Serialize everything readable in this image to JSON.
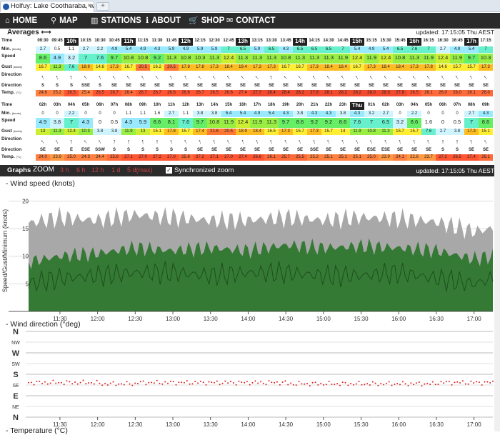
{
  "browser": {
    "tab_title": "Holfuy: Lake Cootharaba, w...",
    "tab_close": "×",
    "new_tab": "+"
  },
  "nav": [
    {
      "icon": "⌂",
      "icon_name": "home-icon",
      "label": "HOME",
      "x": 2
    },
    {
      "icon": "⚲",
      "icon_name": "map-icon",
      "label": "MAP",
      "x": 66
    },
    {
      "icon": "▥",
      "icon_name": "stations-icon",
      "label": "STATIONS",
      "x": 122
    },
    {
      "icon": "ℹ",
      "icon_name": "info-icon",
      "label": "ABOUT",
      "x": 199
    },
    {
      "icon": "🛒",
      "icon_name": "cart-icon",
      "label": "SHOP",
      "x": 259
    },
    {
      "icon": "✉",
      "icon_name": "mail-icon",
      "label": "CONTACT",
      "x": 312
    }
  ],
  "averages": {
    "title": "Averages ⟷",
    "updated": "updated: 17:15:05 Thu AEST"
  },
  "row_labels": {
    "time": "Time",
    "min": "Min.",
    "min_unit": "(knots)",
    "speed": "Speed",
    "gust": "Gust",
    "gust_unit": "(knots)",
    "direction": "Direction",
    "temp": "Temp.",
    "temp_unit": "(°C)"
  },
  "table1": {
    "time": [
      "09:30",
      "09:45",
      "10h",
      "10:15",
      "10:30",
      "10:45",
      "11h",
      "11:15",
      "11:30",
      "11:45",
      "12h",
      "12:15",
      "12:30",
      "12:45",
      "13h",
      "13:15",
      "13:30",
      "13:45",
      "14h",
      "14:15",
      "14:30",
      "14:45",
      "15h",
      "15:15",
      "15:30",
      "15:45",
      "16h",
      "16:15",
      "16:30",
      "16:45",
      "17h",
      "17:15"
    ],
    "min": [
      "2.7",
      "0.5",
      "1.1",
      "2.7",
      "2.2",
      "4.9",
      "5.4",
      "4.9",
      "4.3",
      "5.9",
      "4.9",
      "5.9",
      "5.9",
      "7",
      "6.5",
      "5.9",
      "6.5",
      "4.3",
      "6.5",
      "6.5",
      "6.5",
      "7",
      "5.4",
      "4.9",
      "5.4",
      "6.5",
      "7.6",
      "7",
      "2.7",
      "4.9",
      "5.4",
      "7"
    ],
    "speed": [
      "8.6",
      "4.9",
      "3.2",
      "7",
      "7.6",
      "9.7",
      "10.8",
      "10.8",
      "9.2",
      "11.3",
      "10.8",
      "10.3",
      "11.3",
      "12.4",
      "11.3",
      "11.3",
      "11.3",
      "10.8",
      "11.3",
      "11.3",
      "11.3",
      "11.9",
      "12.4",
      "11.9",
      "12.4",
      "10.8",
      "11.3",
      "11.9",
      "12.4",
      "11.9",
      "9.7",
      "10.3"
    ],
    "gust": [
      "16.7",
      "11.3",
      "7.6",
      "18.9",
      "14.6",
      "17.3",
      "16.7",
      "20.5",
      "16.2",
      "20.5",
      "17.8",
      "17.8",
      "17.3",
      "18.4",
      "19.4",
      "17.3",
      "17.3",
      "16.7",
      "16.7",
      "17.3",
      "18.4",
      "18.4",
      "16.7",
      "17.3",
      "18.4",
      "18.4",
      "17.3",
      "17.8",
      "14.6",
      "15.7",
      "15.7",
      "17.3"
    ],
    "dir": [
      340,
      -10,
      -20,
      320,
      -20,
      320,
      320,
      -30,
      320,
      330,
      -20,
      315,
      320,
      325,
      320,
      315,
      -20,
      310,
      315,
      325,
      320,
      325,
      -30,
      320,
      320,
      310,
      315,
      320,
      -30,
      325,
      330,
      320
    ],
    "dirtext": [
      "S",
      "S",
      "S",
      "SSE",
      "S",
      "SE",
      "SE",
      "SE",
      "SE",
      "SE",
      "SE",
      "SE",
      "SE",
      "SE",
      "SE",
      "SE",
      "SE",
      "SE",
      "SE",
      "SE",
      "SE",
      "SE",
      "SE",
      "SE",
      "SE",
      "SE",
      "SE",
      "SE",
      "SE",
      "SE",
      "SE",
      "SE"
    ],
    "temp": [
      "24.6",
      "25.2",
      "26.5",
      "25.4",
      "26.5",
      "26.7",
      "26.4",
      "26.7",
      "26.7",
      "26.6",
      "26.6",
      "26.7",
      "26.5",
      "26.6",
      "27.4",
      "27.7",
      "28.4",
      "28.4",
      "28.2",
      "27.8",
      "28.1",
      "28.2",
      "28.2",
      "28.0",
      "28.3",
      "27.8",
      "26.5",
      "26.1",
      "26.0",
      "26.0",
      "26.1",
      "26.0"
    ]
  },
  "table2": {
    "time": [
      "02h",
      "03h",
      "04h",
      "05h",
      "06h",
      "07h",
      "08h",
      "09h",
      "10h",
      "11h",
      "12h",
      "13h",
      "14h",
      "15h",
      "16h",
      "17h",
      "18h",
      "19h",
      "20h",
      "21h",
      "22h",
      "23h",
      "Thu",
      "01h",
      "02h",
      "03h",
      "04h",
      "05h",
      "06h",
      "07h",
      "08h",
      "09h"
    ],
    "min": [
      "0",
      "0",
      "2.2",
      "0",
      "0",
      "0",
      "1.1",
      "1.1",
      "1.6",
      "2.7",
      "1.1",
      "3.8",
      "3.8",
      "5.4",
      "5.4",
      "4.9",
      "5.4",
      "4.3",
      "3.8",
      "4.3",
      "4.3",
      "3.8",
      "4.3",
      "3.2",
      "2.7",
      "0",
      "2.2",
      "0",
      "0",
      "0",
      "2.7",
      "4.3"
    ],
    "speed": [
      "4.9",
      "3.8",
      "7",
      "4.3",
      "0",
      "0.5",
      "4.3",
      "5.9",
      "8.6",
      "8.1",
      "7.6",
      "9.7",
      "10.8",
      "11.9",
      "12.4",
      "11.9",
      "11.3",
      "9.7",
      "8.6",
      "9.2",
      "9.2",
      "8.6",
      "7.6",
      "7",
      "6.5",
      "3.2",
      "8.6",
      "1.6",
      "0",
      "0.5",
      "7",
      "8.6"
    ],
    "gust": [
      "13",
      "11.3",
      "12.4",
      "10.3",
      "3.8",
      "3.8",
      "11.9",
      "13",
      "15.1",
      "17.8",
      "15.7",
      "17.4",
      "21.6",
      "20.5",
      "18.9",
      "18.4",
      "16.5",
      "17.3",
      "15.7",
      "17.3",
      "15.7",
      "14",
      "11.9",
      "10.8",
      "11.3",
      "15.7",
      "15.7",
      "7.6",
      "2.7",
      "3.8",
      "17.3",
      "15.1"
    ],
    "dir": [
      320,
      330,
      350,
      320,
      -30,
      5,
      0,
      -5,
      0,
      -20,
      -25,
      -20,
      -20,
      -30,
      -15,
      -20,
      -25,
      -20,
      -25,
      -20,
      -25,
      -20,
      -30,
      -30,
      -20,
      -10,
      -15,
      -25,
      0,
      0,
      -20,
      -30
    ],
    "dirtext": [
      "SE",
      "SE",
      "E",
      "ESE",
      "SSW",
      "S",
      "S",
      "S",
      "S",
      "S",
      "S",
      "SE",
      "SE",
      "SE",
      "SE",
      "SE",
      "SE",
      "SE",
      "SE",
      "SSE",
      "SE",
      "SE",
      "SE",
      "ESE",
      "ESE",
      "SE",
      "SE",
      "SE",
      "S",
      "S",
      "SE",
      "SE"
    ],
    "temp": [
      "24.0",
      "23.9",
      "25.0",
      "24.3",
      "24.4",
      "25.8",
      "27.1",
      "27.0",
      "27.2",
      "27.0",
      "25.8",
      "27.2",
      "27.1",
      "27.0",
      "27.4",
      "26.6",
      "26.1",
      "25.7",
      "25.5",
      "25.2",
      "25.1",
      "25.1",
      "25.1",
      "25.0",
      "23.9",
      "24.1",
      "22.6",
      "23.7",
      "27.2",
      "26.5",
      "27.4",
      "26.1"
    ]
  },
  "graphs": {
    "label": "Graphs",
    "zoom": "ZOOM",
    "zoom_options": [
      "3 h",
      "6 h",
      "12 h",
      "1 d",
      "5 d(max)"
    ],
    "sync_label": "Synchronized zoom",
    "sync_check": "✓",
    "updated": "updated: 17:15:05 Thu AEST"
  },
  "chart_wind": {
    "title": "- Wind speed (knots)",
    "ylabel": "Speed/Gust/Minimum (knots)",
    "yticks": [
      "20",
      "15",
      "10",
      "5"
    ]
  },
  "chart_dir": {
    "title": "- Wind direction (°deg)",
    "yticks": [
      "N",
      "NW",
      "W",
      "SW",
      "S",
      "SE",
      "E",
      "NE",
      "N"
    ]
  },
  "chart_temp": {
    "title": "- Temperature (°C)"
  },
  "xticks": [
    "11:30",
    "12:00",
    "12:30",
    "13:00",
    "13:30",
    "14:00",
    "14:30",
    "15:00",
    "15:30",
    "16:00",
    "16:30",
    "17:00"
  ],
  "chart_data": [
    {
      "type": "area",
      "title": "Wind speed (knots)",
      "ylabel": "Speed/Gust/Minimum (knots)",
      "ylim": [
        0,
        22
      ],
      "x": [
        "11:05",
        "11:30",
        "12:00",
        "12:30",
        "13:00",
        "13:30",
        "14:00",
        "14:30",
        "15:00",
        "15:30",
        "16:00",
        "16:30",
        "17:00",
        "17:15"
      ],
      "series": [
        {
          "name": "Gust",
          "values": [
            16,
            17,
            16.5,
            17.5,
            17,
            16.5,
            16.5,
            17,
            16.5,
            17,
            16.8,
            16.2,
            14.5,
            15
          ]
        },
        {
          "name": "Speed",
          "values": [
            9,
            10,
            10.5,
            11.5,
            11,
            11.5,
            11,
            12,
            11.5,
            11.8,
            11.5,
            11,
            9.5,
            10
          ]
        },
        {
          "name": "Minimum",
          "values": [
            5,
            6,
            6.5,
            7,
            7,
            6.5,
            7,
            7,
            6.5,
            6.5,
            7,
            6,
            5,
            6
          ]
        }
      ]
    },
    {
      "type": "scatter",
      "title": "Wind direction (°deg)",
      "y_categories": [
        "N",
        "NW",
        "W",
        "SW",
        "S",
        "SE",
        "E",
        "NE",
        "N"
      ],
      "x": [
        "11:30",
        "12:00",
        "12:30",
        "13:00",
        "13:30",
        "14:00",
        "14:30",
        "15:00",
        "15:30",
        "16:00",
        "16:30",
        "17:00"
      ],
      "values": [
        145,
        140,
        145,
        145,
        145,
        145,
        140,
        140,
        140,
        140,
        145,
        140
      ]
    }
  ]
}
